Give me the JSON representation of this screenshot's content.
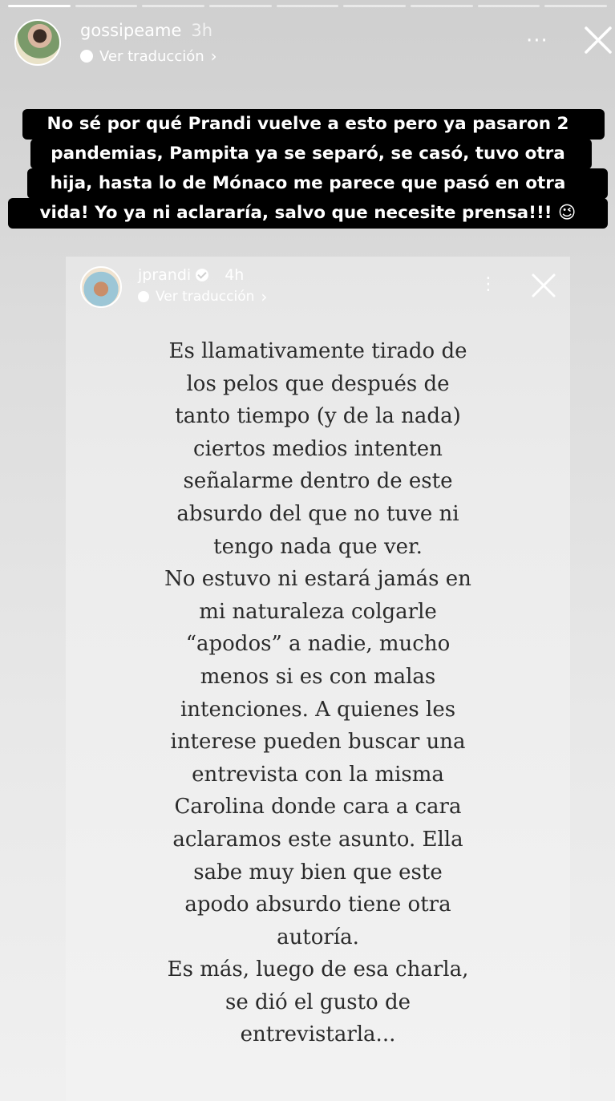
{
  "story": {
    "progress_segments": 9,
    "active_segment": 0,
    "username": "gossipeame",
    "time": "3h",
    "translate_label": "Ver traducción",
    "chevron": "›",
    "more": "···",
    "caption_lines": [
      "No sé por qué Prandi vuelve a esto pero ya pasaron 2",
      "pandemias, Pampita ya se separó, se casó, tuvo otra",
      "hija, hasta lo de Mónaco me parece que pasó en otra",
      "vida! Yo ya ni aclararía, salvo que necesite prensa!!! 😉"
    ]
  },
  "embedded_story": {
    "username": "jprandi",
    "time": "4h",
    "translate_label": "Ver traducción",
    "chevron": "›",
    "more": "⋮",
    "statement_lines": [
      "Es llamativamente tirado de",
      "los pelos que después de",
      "tanto tiempo (y de la nada)",
      "ciertos medios intenten",
      "señalarme dentro de este",
      "absurdo del que no tuve ni",
      "tengo nada que ver.",
      "No estuvo ni estará jamás en",
      "mi naturaleza colgarle",
      "“apodos” a nadie, mucho",
      "menos si es con malas",
      "intenciones. A quienes les",
      "interese pueden buscar una",
      "entrevista con la misma",
      "Carolina donde cara a cara",
      "aclaramos este asunto. Ella",
      "sabe muy bien que este",
      "apodo absurdo tiene otra",
      "autoría.",
      "Es más, luego de esa charla,",
      "se dió el gusto de",
      "entrevistarla..."
    ]
  }
}
